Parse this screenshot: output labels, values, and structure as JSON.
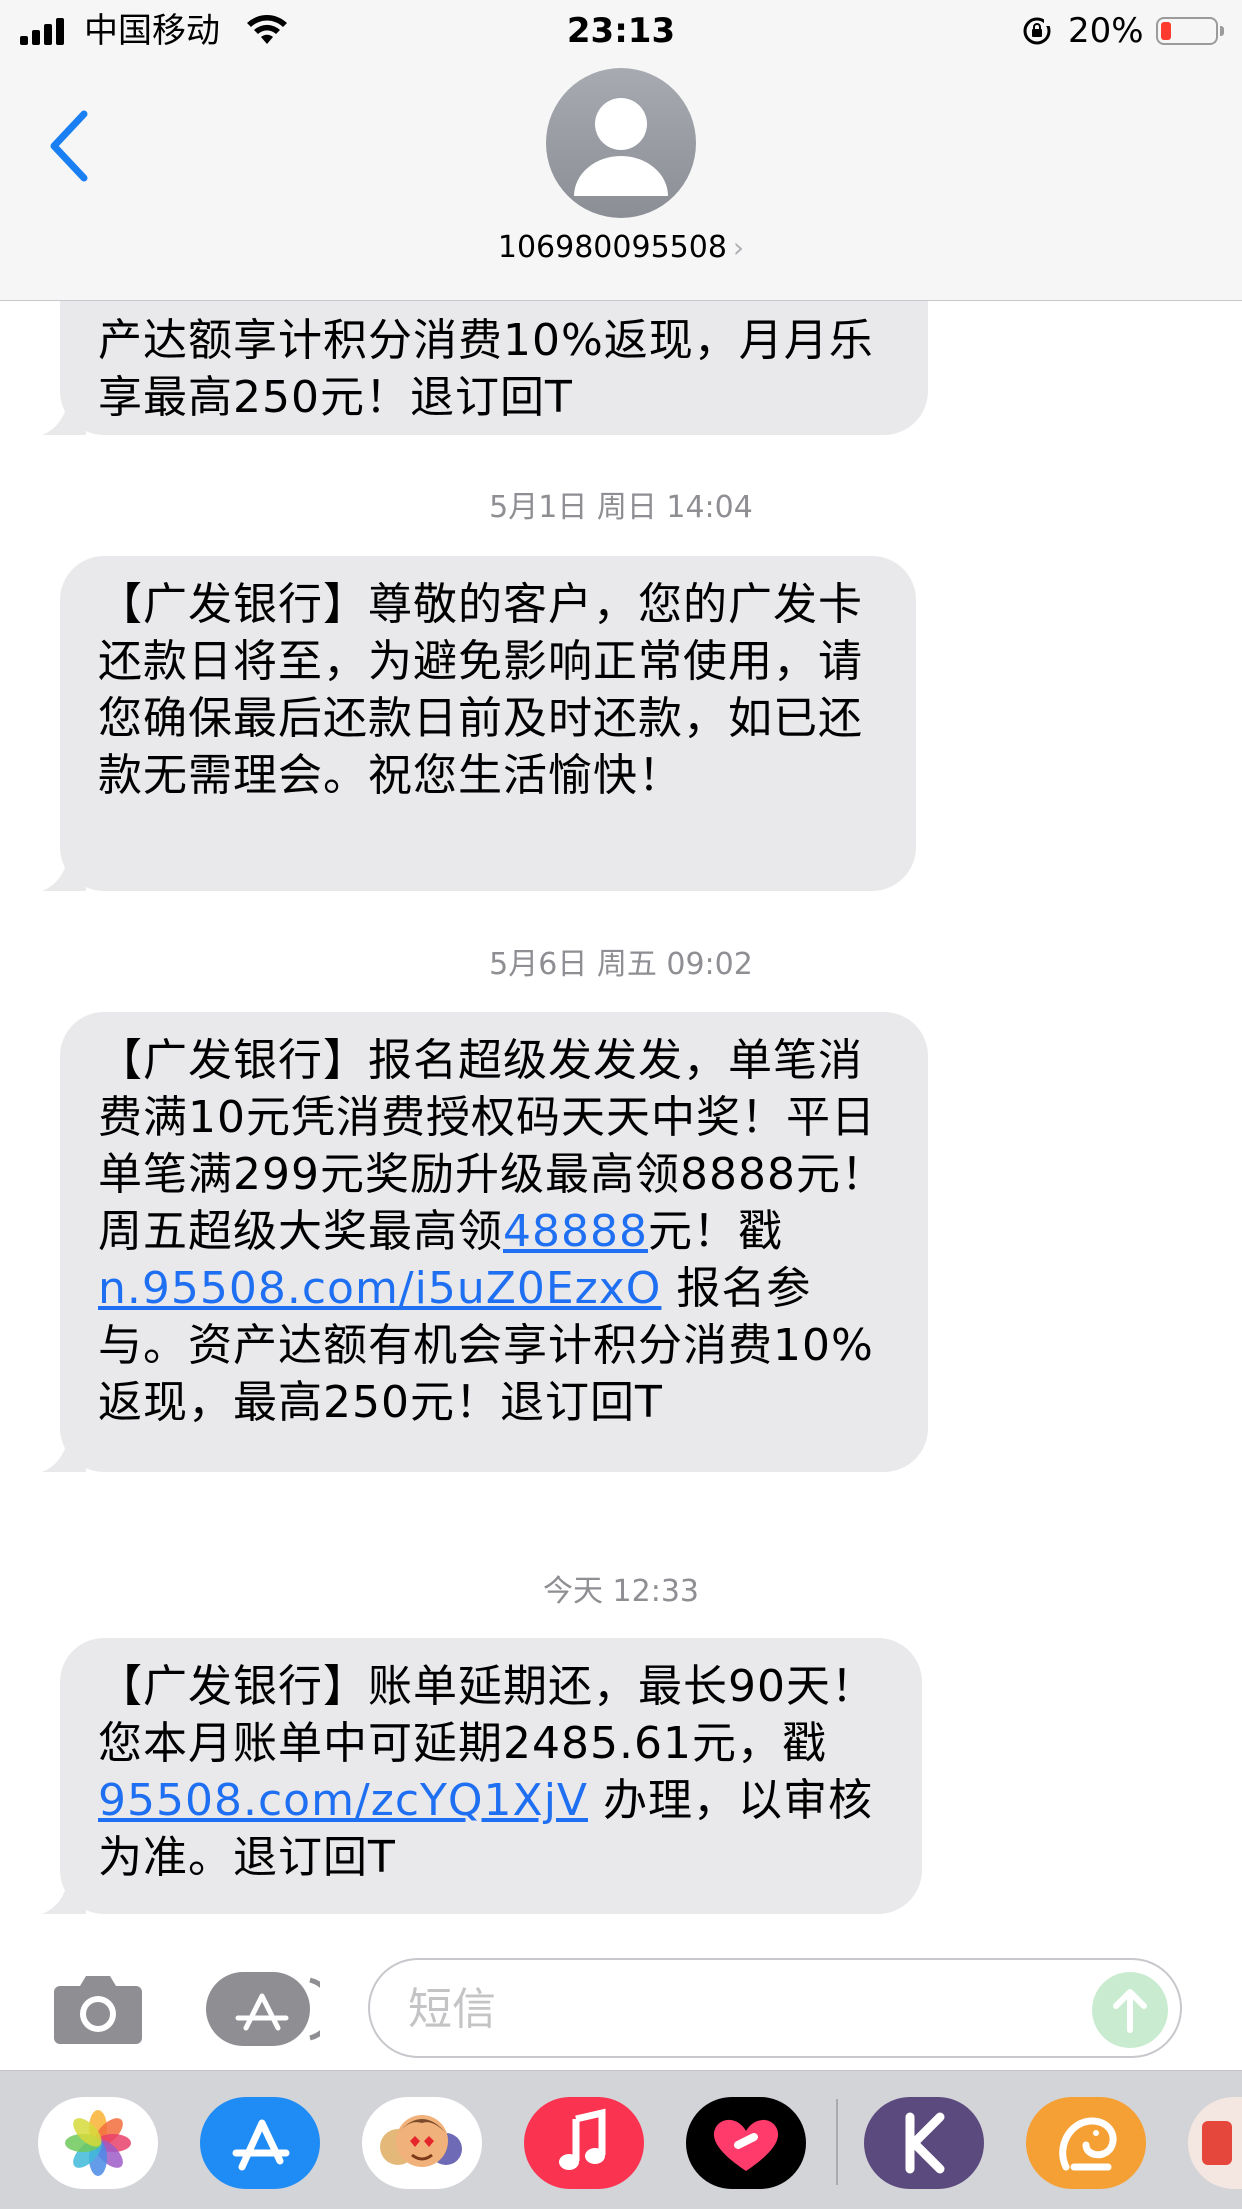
{
  "status_bar": {
    "carrier": "中国移动",
    "time": "23:13",
    "battery_percent": "20%",
    "battery_level": 0.2,
    "battery_color": "#ff3b30"
  },
  "header": {
    "back_icon": "chevron-left-icon",
    "contact_number": "106980095508",
    "contact_chevron": "›"
  },
  "messages": [
    {
      "timestamp": "",
      "text_parts": [
        {
          "text": "产达额享计积分消费10%返现，月月乐享最高250元！退订回T",
          "link": false
        }
      ]
    },
    {
      "timestamp": "5月1日 周日 14:04",
      "text_parts": [
        {
          "text": "【广发银行】尊敬的客户，您的广发卡还款日将至，为避免影响正常使用，请您确保最后还款日前及时还款，如已还款无需理会。祝您生活愉快！",
          "link": false
        }
      ]
    },
    {
      "timestamp": "5月6日 周五 09:02",
      "text_parts": [
        {
          "text": "【广发银行】报名超级发发发，单笔消费满10元凭消费授权码天天中奖！平日单笔满299元奖励升级最高领8888元！周五超级大奖最高领",
          "link": false
        },
        {
          "text": "48888",
          "link": true
        },
        {
          "text": "元！戳 ",
          "link": false
        },
        {
          "text": "n.95508.com/i5uZ0EzxO",
          "link": true
        },
        {
          "text": " 报名参与。资产达额有机会享计积分消费10%返现，最高250元！退订回T",
          "link": false
        }
      ]
    },
    {
      "timestamp": "今天 12:33",
      "text_parts": [
        {
          "text": "【广发银行】账单延期还，最长90天！您本月账单中可延期2485.61元，戳 ",
          "link": false
        },
        {
          "text": "95508.com/zcYQ1XjV",
          "link": true
        },
        {
          "text": " 办理，以审核为准。退订回T",
          "link": false
        }
      ]
    }
  ],
  "composer": {
    "placeholder": "短信",
    "value": "",
    "camera_icon": "camera-icon",
    "apps_icon": "app-store-icon",
    "send_icon": "arrow-up-icon"
  },
  "app_drawer": [
    {
      "name": "photos",
      "icon": "photos-icon",
      "color": "#ffffff"
    },
    {
      "name": "app-store",
      "icon": "app-store-icon",
      "color": "#1f8cf5"
    },
    {
      "name": "memoji",
      "icon": "memoji-icon",
      "color": "#ffffff"
    },
    {
      "name": "music",
      "icon": "music-note-icon",
      "color": "#fa3350"
    },
    {
      "name": "digital-touch",
      "icon": "heart-icon",
      "color": "#000000"
    },
    {
      "name": "k-app",
      "icon": "k-letter-icon",
      "color": "#5b4a7e"
    },
    {
      "name": "uc-browser",
      "icon": "squirrel-icon",
      "color": "#f5a034"
    },
    {
      "name": "partial-app",
      "icon": "app-icon",
      "color": "#f4e6e0"
    }
  ],
  "colors": {
    "bubble_bg": "#e9e9eb",
    "link": "#1f6ff2",
    "ios_blue": "#1a7ff3",
    "timestamp": "#8e8e93"
  }
}
